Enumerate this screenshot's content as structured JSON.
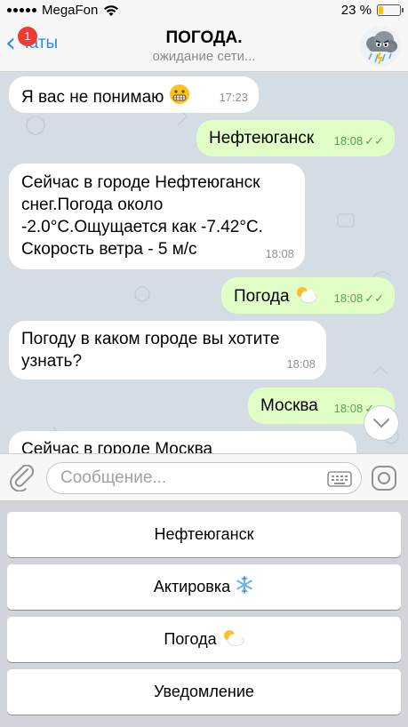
{
  "status_bar": {
    "carrier": "MegaFon",
    "battery_text": "23 %",
    "battery_level": 0.23
  },
  "nav": {
    "back_label": "Чаты",
    "unread_badge": "1",
    "title": "ПОГОДА.",
    "subtitle": "ожидание сети..."
  },
  "messages": [
    {
      "direction": "in",
      "text": "Я вас не понимаю",
      "emoji": "grimace",
      "time": "17:23"
    },
    {
      "direction": "out",
      "text": "Нефтеюганск",
      "time": "18:08",
      "read": true
    },
    {
      "direction": "in",
      "lines": [
        "Сейчас в городе Нефтеюганск",
        "снег.Погода около",
        "-2.0°С.Ощущается как -7.42°С.",
        "Скорость ветра - 5 м/с"
      ],
      "time": "18:08"
    },
    {
      "direction": "out",
      "text": "Погода",
      "emoji": "sun-behind-cloud",
      "time": "18:08",
      "read": true
    },
    {
      "direction": "in",
      "lines": [
        "Погоду в каком городе вы хотите",
        "узнать?"
      ],
      "time": "18:08"
    },
    {
      "direction": "out",
      "text": "Москва",
      "time": "18:08",
      "read": true
    },
    {
      "direction": "in",
      "text": "Сейчас в городе Москва"
    }
  ],
  "composer": {
    "placeholder": "Сообщение..."
  },
  "keyboard_buttons": [
    {
      "label": "Нефтеюганск",
      "emoji": ""
    },
    {
      "label": "Актировка",
      "emoji": "snowflake"
    },
    {
      "label": "Погода",
      "emoji": "sun-behind-cloud"
    },
    {
      "label": "Уведомление",
      "emoji": ""
    }
  ],
  "colors": {
    "accent": "#2a8bf2",
    "outgoing_bubble": "#e1fec6",
    "incoming_bubble": "#ffffff",
    "badge": "#ef3b34",
    "chat_background": "#d4dde3"
  }
}
